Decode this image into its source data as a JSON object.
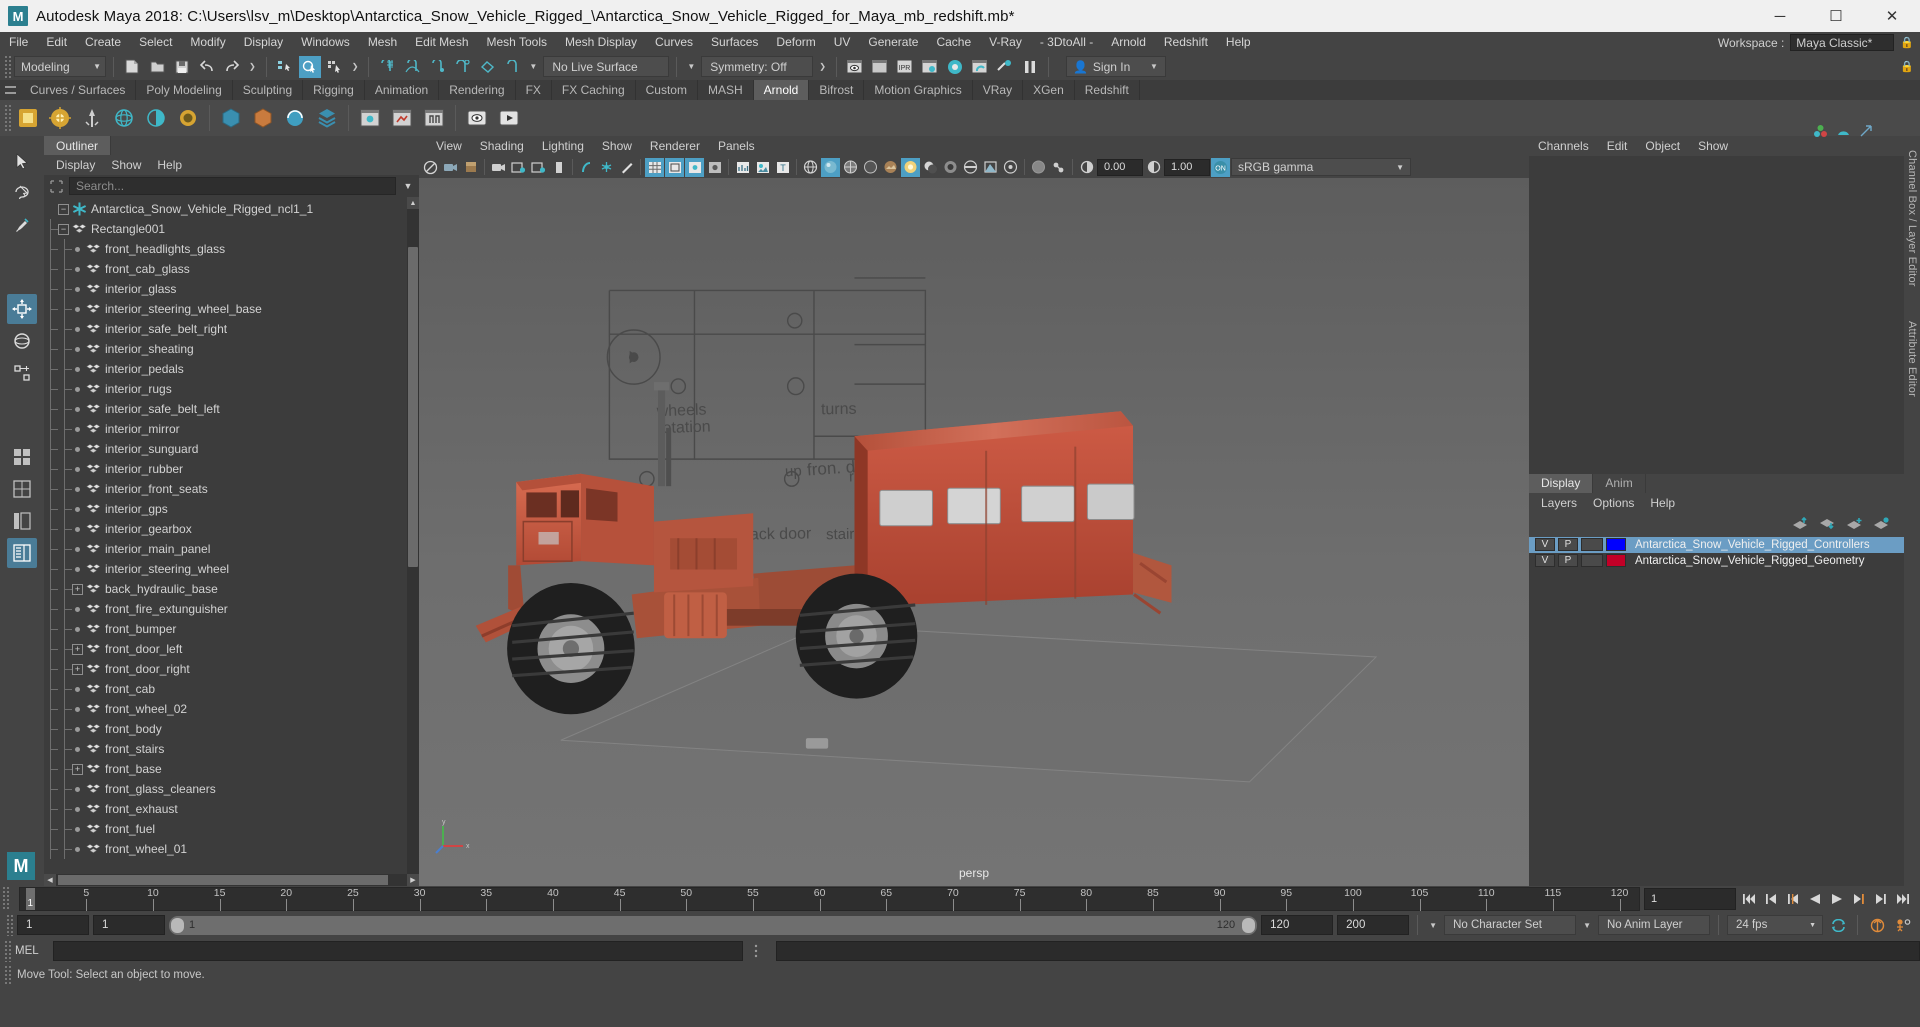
{
  "titlebar": {
    "app_title": "Autodesk Maya 2018: C:\\Users\\lsv_m\\Desktop\\Antarctica_Snow_Vehicle_Rigged_\\Antarctica_Snow_Vehicle_Rigged_for_Maya_mb_redshift.mb*",
    "logo_text": "M",
    "minimize": "─",
    "maximize": "☐",
    "close": "✕"
  },
  "menubar": {
    "items": [
      "File",
      "Edit",
      "Create",
      "Select",
      "Modify",
      "Display",
      "Windows",
      "Mesh",
      "Edit Mesh",
      "Mesh Tools",
      "Mesh Display",
      "Curves",
      "Surfaces",
      "Deform",
      "UV",
      "Generate",
      "Cache",
      "V-Ray",
      "- 3DtoAll -",
      "Arnold",
      "Redshift",
      "Help"
    ],
    "workspace_label": "Workspace :",
    "workspace_value": "Maya Classic*"
  },
  "statusbar": {
    "mode": "Modeling",
    "live_surface": "No Live Surface",
    "symmetry": "Symmetry: Off",
    "signin": "Sign In"
  },
  "shelf_tabs": {
    "active": "Arnold",
    "items": [
      "Curves / Surfaces",
      "Poly Modeling",
      "Sculpting",
      "Rigging",
      "Animation",
      "Rendering",
      "FX",
      "FX Caching",
      "Custom",
      "MASH",
      "Arnold",
      "Bifrost",
      "Motion Graphics",
      "VRay",
      "XGen",
      "Redshift"
    ]
  },
  "outliner": {
    "tab": "Outliner",
    "menu": [
      "Display",
      "Show",
      "Help"
    ],
    "search_placeholder": "Search...",
    "items": [
      {
        "label": "Antarctica_Snow_Vehicle_Rigged_ncl1_1",
        "depth": 0,
        "toggle": "minus",
        "icon": "star"
      },
      {
        "label": "Rectangle001",
        "depth": 1,
        "toggle": "minus",
        "icon": "mesh"
      },
      {
        "label": "front_headlights_glass",
        "depth": 2,
        "toggle": "leaf",
        "icon": "mesh"
      },
      {
        "label": "front_cab_glass",
        "depth": 2,
        "toggle": "leaf",
        "icon": "mesh"
      },
      {
        "label": "interior_glass",
        "depth": 2,
        "toggle": "leaf",
        "icon": "mesh"
      },
      {
        "label": "interior_steering_wheel_base",
        "depth": 2,
        "toggle": "leaf",
        "icon": "mesh"
      },
      {
        "label": "interior_safe_belt_right",
        "depth": 2,
        "toggle": "leaf",
        "icon": "mesh"
      },
      {
        "label": "interior_sheating",
        "depth": 2,
        "toggle": "leaf",
        "icon": "mesh"
      },
      {
        "label": "interior_pedals",
        "depth": 2,
        "toggle": "leaf",
        "icon": "mesh"
      },
      {
        "label": "interior_rugs",
        "depth": 2,
        "toggle": "leaf",
        "icon": "mesh"
      },
      {
        "label": "interior_safe_belt_left",
        "depth": 2,
        "toggle": "leaf",
        "icon": "mesh"
      },
      {
        "label": "interior_mirror",
        "depth": 2,
        "toggle": "leaf",
        "icon": "mesh"
      },
      {
        "label": "interior_sunguard",
        "depth": 2,
        "toggle": "leaf",
        "icon": "mesh"
      },
      {
        "label": "interior_rubber",
        "depth": 2,
        "toggle": "leaf",
        "icon": "mesh"
      },
      {
        "label": "interior_front_seats",
        "depth": 2,
        "toggle": "leaf",
        "icon": "mesh"
      },
      {
        "label": "interior_gps",
        "depth": 2,
        "toggle": "leaf",
        "icon": "mesh"
      },
      {
        "label": "interior_gearbox",
        "depth": 2,
        "toggle": "leaf",
        "icon": "mesh"
      },
      {
        "label": "interior_main_panel",
        "depth": 2,
        "toggle": "leaf",
        "icon": "mesh"
      },
      {
        "label": "interior_steering_wheel",
        "depth": 2,
        "toggle": "leaf",
        "icon": "mesh"
      },
      {
        "label": "back_hydraulic_base",
        "depth": 2,
        "toggle": "plus",
        "icon": "mesh"
      },
      {
        "label": "front_fire_extunguisher",
        "depth": 2,
        "toggle": "leaf",
        "icon": "mesh"
      },
      {
        "label": "front_bumper",
        "depth": 2,
        "toggle": "leaf",
        "icon": "mesh"
      },
      {
        "label": "front_door_left",
        "depth": 2,
        "toggle": "plus",
        "icon": "mesh"
      },
      {
        "label": "front_door_right",
        "depth": 2,
        "toggle": "plus",
        "icon": "mesh"
      },
      {
        "label": "front_cab",
        "depth": 2,
        "toggle": "leaf",
        "icon": "mesh"
      },
      {
        "label": "front_wheel_02",
        "depth": 2,
        "toggle": "leaf",
        "icon": "mesh"
      },
      {
        "label": "front_body",
        "depth": 2,
        "toggle": "leaf",
        "icon": "mesh"
      },
      {
        "label": "front_stairs",
        "depth": 2,
        "toggle": "leaf",
        "icon": "mesh"
      },
      {
        "label": "front_base",
        "depth": 2,
        "toggle": "plus",
        "icon": "mesh"
      },
      {
        "label": "front_glass_cleaners",
        "depth": 2,
        "toggle": "leaf",
        "icon": "mesh"
      },
      {
        "label": "front_exhaust",
        "depth": 2,
        "toggle": "leaf",
        "icon": "mesh"
      },
      {
        "label": "front_fuel",
        "depth": 2,
        "toggle": "leaf",
        "icon": "mesh"
      },
      {
        "label": "front_wheel_01",
        "depth": 2,
        "toggle": "leaf",
        "icon": "mesh"
      }
    ]
  },
  "viewport": {
    "menu": [
      "View",
      "Shading",
      "Lighting",
      "Show",
      "Renderer",
      "Panels"
    ],
    "exposure": "0.00",
    "gamma_value": "1.00",
    "color_space": "sRGB gamma",
    "camera_label": "persp",
    "annotations": [
      "wheels rotation",
      "turns",
      "fron. door",
      "up",
      "right",
      "back door",
      "stair"
    ]
  },
  "channelbox": {
    "menu": [
      "Channels",
      "Edit",
      "Object",
      "Show"
    ],
    "side_label": "Channel Box / Layer Editor",
    "attr_side_label": "Attribute Editor"
  },
  "layers": {
    "tabs": [
      "Display",
      "Anim"
    ],
    "active_tab": "Display",
    "menu": [
      "Layers",
      "Options",
      "Help"
    ],
    "rows": [
      {
        "v": "V",
        "p": "P",
        "color": "#0000ff",
        "name": "Antarctica_Snow_Vehicle_Rigged_Controllers",
        "selected": true
      },
      {
        "v": "V",
        "p": "P",
        "color": "#c20027",
        "name": "Antarctica_Snow_Vehicle_Rigged_Geometry",
        "selected": false
      }
    ]
  },
  "timeline": {
    "current_frame": "1",
    "ticks": [
      5,
      10,
      15,
      20,
      25,
      30,
      35,
      40,
      45,
      50,
      55,
      60,
      65,
      70,
      75,
      80,
      85,
      90,
      95,
      100,
      105,
      110,
      115,
      120
    ],
    "range_start": 1,
    "range_end": 120,
    "frame_field": "1"
  },
  "rangebar": {
    "anim_start": "1",
    "range_start": "1",
    "slider_min_label": "1",
    "slider_max_label": "120",
    "range_end": "120",
    "anim_end": "200",
    "character_set": "No Character Set",
    "anim_layer": "No Anim Layer",
    "fps": "24 fps"
  },
  "commandline": {
    "language": "MEL",
    "input_value": "",
    "output_value": ""
  },
  "helpline": {
    "text": "Move Tool: Select an object to move."
  },
  "colors": {
    "accent_teal": "#4d9fc4",
    "select_blue": "#6b9dc4",
    "background": "#444444",
    "panel": "#3c3c3c",
    "controller_layer": "#0000ff",
    "geometry_layer": "#c20027"
  }
}
